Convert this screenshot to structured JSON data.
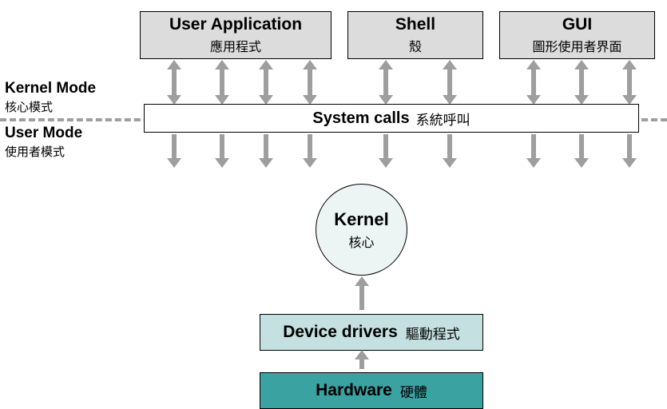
{
  "top": {
    "userApp": {
      "en": "User Application",
      "zh": "應用程式"
    },
    "shell": {
      "en": "Shell",
      "zh": "殼"
    },
    "gui": {
      "en": "GUI",
      "zh": "圖形使用者界面"
    }
  },
  "modes": {
    "kernel": {
      "en": "Kernel Mode",
      "zh": "核心模式"
    },
    "user": {
      "en": "User Mode",
      "zh": "使用者模式"
    }
  },
  "syscalls": {
    "en": "System calls",
    "zh": "系統呼叫"
  },
  "kernel": {
    "en": "Kernel",
    "zh": "核心"
  },
  "drivers": {
    "en": "Device drivers",
    "zh": "驅動程式"
  },
  "hardware": {
    "en": "Hardware",
    "zh": "硬體"
  },
  "colors": {
    "topBox": "#dcdcdc",
    "drivers": "#c4e0e0",
    "hardware": "#3aa2a1",
    "kernelFill": "#ecf5f4",
    "arrow": "#9e9e9e"
  }
}
